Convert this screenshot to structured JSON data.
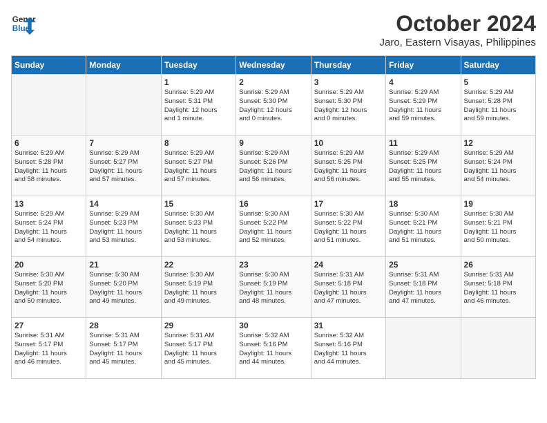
{
  "logo": {
    "text_general": "General",
    "text_blue": "Blue"
  },
  "header": {
    "month": "October 2024",
    "location": "Jaro, Eastern Visayas, Philippines"
  },
  "weekdays": [
    "Sunday",
    "Monday",
    "Tuesday",
    "Wednesday",
    "Thursday",
    "Friday",
    "Saturday"
  ],
  "weeks": [
    [
      {
        "day": "",
        "empty": true,
        "text": ""
      },
      {
        "day": "",
        "empty": true,
        "text": ""
      },
      {
        "day": "1",
        "text": "Sunrise: 5:29 AM\nSunset: 5:31 PM\nDaylight: 12 hours\nand 1 minute."
      },
      {
        "day": "2",
        "text": "Sunrise: 5:29 AM\nSunset: 5:30 PM\nDaylight: 12 hours\nand 0 minutes."
      },
      {
        "day": "3",
        "text": "Sunrise: 5:29 AM\nSunset: 5:30 PM\nDaylight: 12 hours\nand 0 minutes."
      },
      {
        "day": "4",
        "text": "Sunrise: 5:29 AM\nSunset: 5:29 PM\nDaylight: 11 hours\nand 59 minutes."
      },
      {
        "day": "5",
        "text": "Sunrise: 5:29 AM\nSunset: 5:28 PM\nDaylight: 11 hours\nand 59 minutes."
      }
    ],
    [
      {
        "day": "6",
        "text": "Sunrise: 5:29 AM\nSunset: 5:28 PM\nDaylight: 11 hours\nand 58 minutes."
      },
      {
        "day": "7",
        "text": "Sunrise: 5:29 AM\nSunset: 5:27 PM\nDaylight: 11 hours\nand 57 minutes."
      },
      {
        "day": "8",
        "text": "Sunrise: 5:29 AM\nSunset: 5:27 PM\nDaylight: 11 hours\nand 57 minutes."
      },
      {
        "day": "9",
        "text": "Sunrise: 5:29 AM\nSunset: 5:26 PM\nDaylight: 11 hours\nand 56 minutes."
      },
      {
        "day": "10",
        "text": "Sunrise: 5:29 AM\nSunset: 5:25 PM\nDaylight: 11 hours\nand 56 minutes."
      },
      {
        "day": "11",
        "text": "Sunrise: 5:29 AM\nSunset: 5:25 PM\nDaylight: 11 hours\nand 55 minutes."
      },
      {
        "day": "12",
        "text": "Sunrise: 5:29 AM\nSunset: 5:24 PM\nDaylight: 11 hours\nand 54 minutes."
      }
    ],
    [
      {
        "day": "13",
        "text": "Sunrise: 5:29 AM\nSunset: 5:24 PM\nDaylight: 11 hours\nand 54 minutes."
      },
      {
        "day": "14",
        "text": "Sunrise: 5:29 AM\nSunset: 5:23 PM\nDaylight: 11 hours\nand 53 minutes."
      },
      {
        "day": "15",
        "text": "Sunrise: 5:30 AM\nSunset: 5:23 PM\nDaylight: 11 hours\nand 53 minutes."
      },
      {
        "day": "16",
        "text": "Sunrise: 5:30 AM\nSunset: 5:22 PM\nDaylight: 11 hours\nand 52 minutes."
      },
      {
        "day": "17",
        "text": "Sunrise: 5:30 AM\nSunset: 5:22 PM\nDaylight: 11 hours\nand 51 minutes."
      },
      {
        "day": "18",
        "text": "Sunrise: 5:30 AM\nSunset: 5:21 PM\nDaylight: 11 hours\nand 51 minutes."
      },
      {
        "day": "19",
        "text": "Sunrise: 5:30 AM\nSunset: 5:21 PM\nDaylight: 11 hours\nand 50 minutes."
      }
    ],
    [
      {
        "day": "20",
        "text": "Sunrise: 5:30 AM\nSunset: 5:20 PM\nDaylight: 11 hours\nand 50 minutes."
      },
      {
        "day": "21",
        "text": "Sunrise: 5:30 AM\nSunset: 5:20 PM\nDaylight: 11 hours\nand 49 minutes."
      },
      {
        "day": "22",
        "text": "Sunrise: 5:30 AM\nSunset: 5:19 PM\nDaylight: 11 hours\nand 49 minutes."
      },
      {
        "day": "23",
        "text": "Sunrise: 5:30 AM\nSunset: 5:19 PM\nDaylight: 11 hours\nand 48 minutes."
      },
      {
        "day": "24",
        "text": "Sunrise: 5:31 AM\nSunset: 5:18 PM\nDaylight: 11 hours\nand 47 minutes."
      },
      {
        "day": "25",
        "text": "Sunrise: 5:31 AM\nSunset: 5:18 PM\nDaylight: 11 hours\nand 47 minutes."
      },
      {
        "day": "26",
        "text": "Sunrise: 5:31 AM\nSunset: 5:18 PM\nDaylight: 11 hours\nand 46 minutes."
      }
    ],
    [
      {
        "day": "27",
        "text": "Sunrise: 5:31 AM\nSunset: 5:17 PM\nDaylight: 11 hours\nand 46 minutes."
      },
      {
        "day": "28",
        "text": "Sunrise: 5:31 AM\nSunset: 5:17 PM\nDaylight: 11 hours\nand 45 minutes."
      },
      {
        "day": "29",
        "text": "Sunrise: 5:31 AM\nSunset: 5:17 PM\nDaylight: 11 hours\nand 45 minutes."
      },
      {
        "day": "30",
        "text": "Sunrise: 5:32 AM\nSunset: 5:16 PM\nDaylight: 11 hours\nand 44 minutes."
      },
      {
        "day": "31",
        "text": "Sunrise: 5:32 AM\nSunset: 5:16 PM\nDaylight: 11 hours\nand 44 minutes."
      },
      {
        "day": "",
        "empty": true,
        "text": ""
      },
      {
        "day": "",
        "empty": true,
        "text": ""
      }
    ]
  ]
}
